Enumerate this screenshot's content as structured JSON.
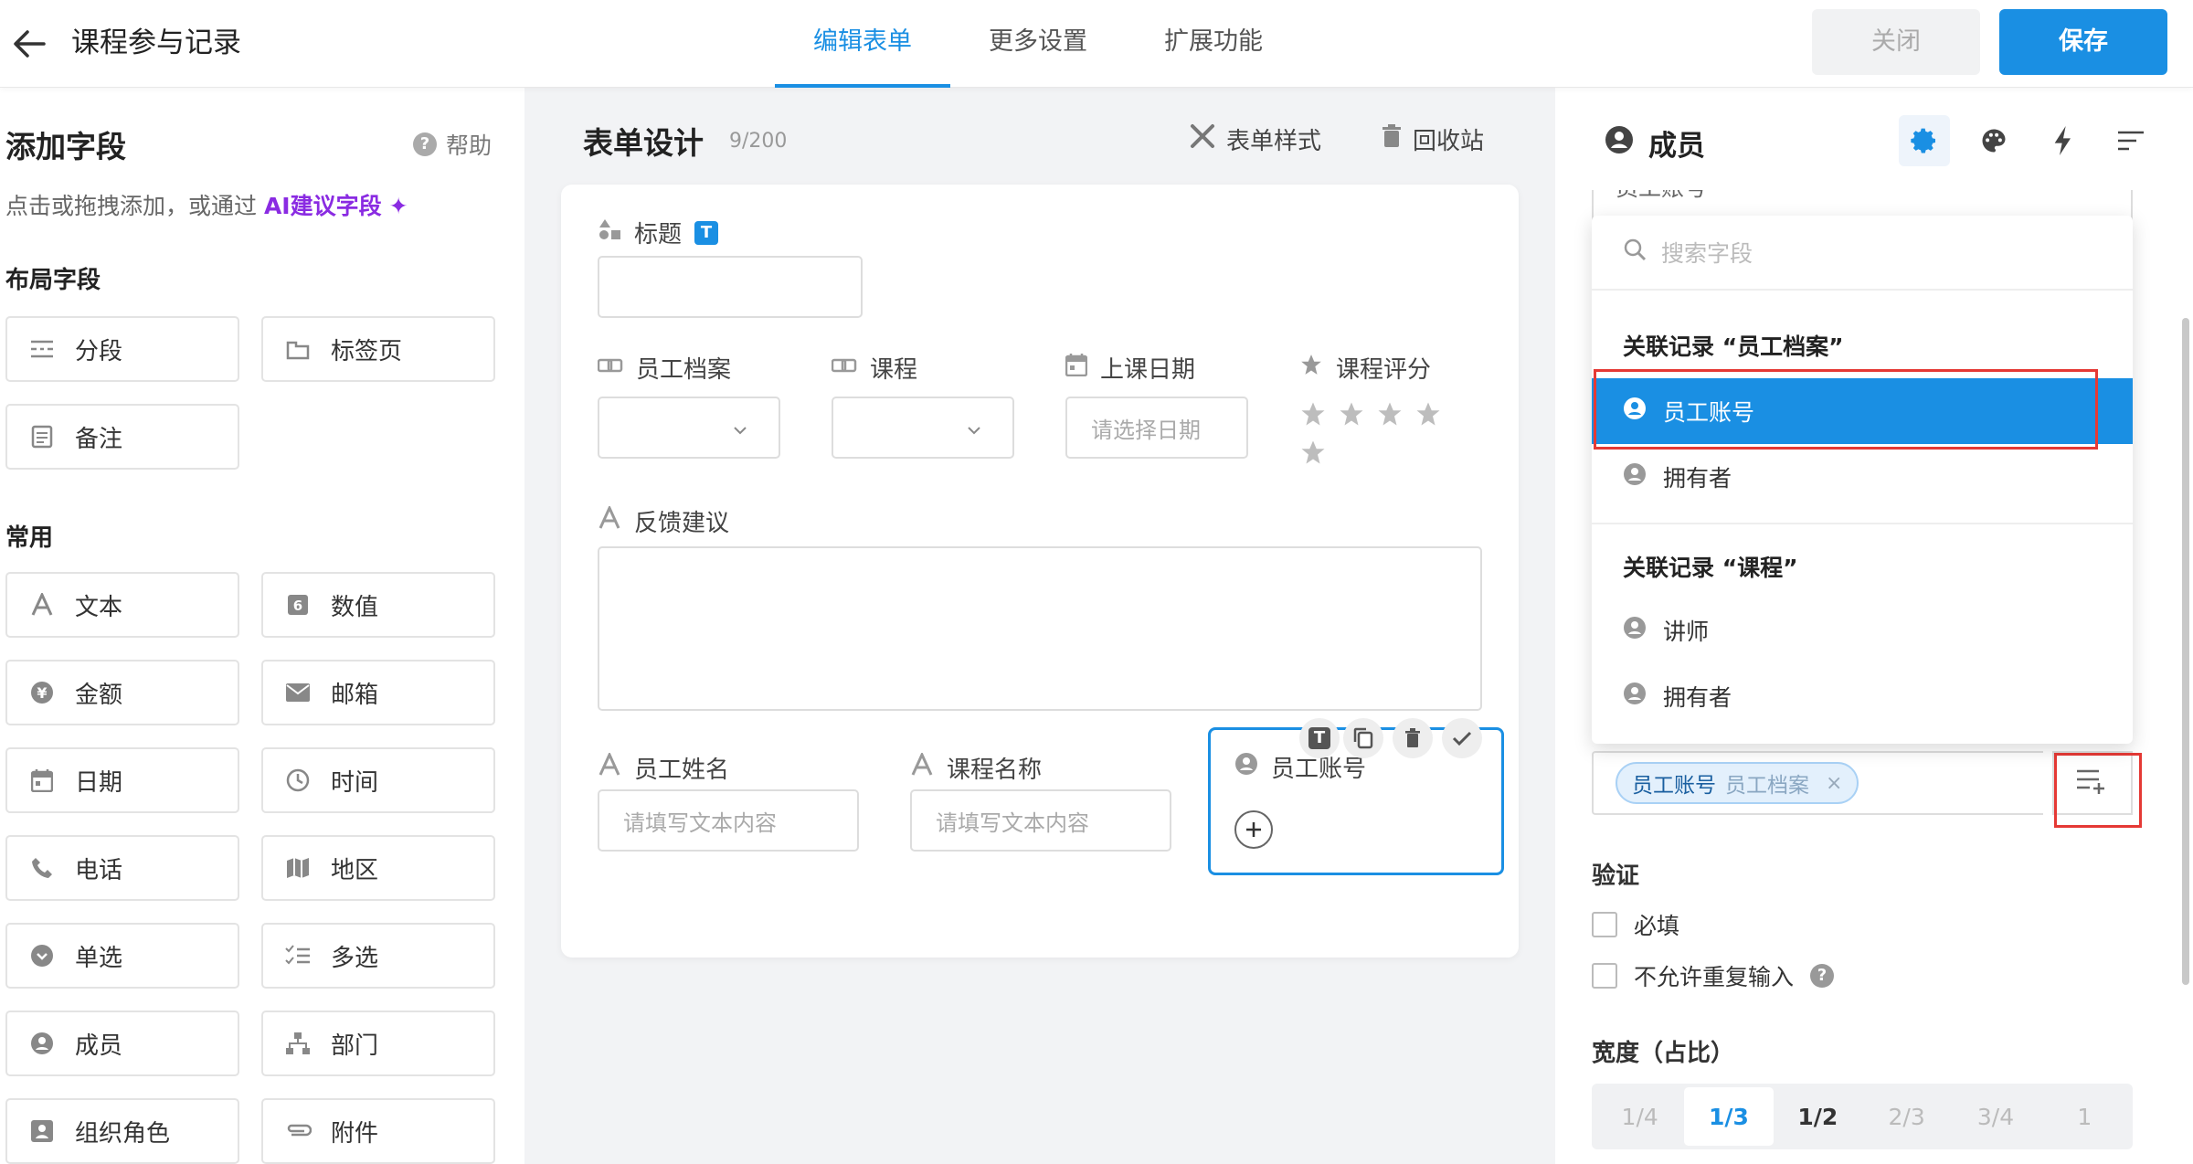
{
  "header": {
    "title": "课程参与记录",
    "tabs": [
      {
        "label": "编辑表单"
      },
      {
        "label": "更多设置"
      },
      {
        "label": "扩展功能"
      }
    ],
    "close_label": "关闭",
    "save_label": "保存",
    "accent": "#1a8fe3"
  },
  "sidebar": {
    "title": "添加字段",
    "help_label": "帮助",
    "hint_prefix": "点击或拖拽添加，或通过 ",
    "hint_ai": "AI建议字段",
    "layout_title": "布局字段",
    "layout_items": [
      {
        "label": "分段",
        "icon": "section-icon"
      },
      {
        "label": "标签页",
        "icon": "tab-page-icon"
      },
      {
        "label": "备注",
        "icon": "note-icon"
      }
    ],
    "common_title": "常用",
    "common_items": [
      {
        "label": "文本",
        "icon": "text-icon"
      },
      {
        "label": "数值",
        "icon": "number-icon"
      },
      {
        "label": "金额",
        "icon": "currency-icon"
      },
      {
        "label": "邮箱",
        "icon": "email-icon"
      },
      {
        "label": "日期",
        "icon": "calendar-icon"
      },
      {
        "label": "时间",
        "icon": "clock-icon"
      },
      {
        "label": "电话",
        "icon": "phone-icon"
      },
      {
        "label": "地区",
        "icon": "map-icon"
      },
      {
        "label": "单选",
        "icon": "radio-icon"
      },
      {
        "label": "多选",
        "icon": "checklist-icon"
      },
      {
        "label": "成员",
        "icon": "member-icon"
      },
      {
        "label": "部门",
        "icon": "org-chart-icon"
      },
      {
        "label": "组织角色",
        "icon": "role-card-icon"
      },
      {
        "label": "附件",
        "icon": "paperclip-icon"
      }
    ]
  },
  "middle": {
    "title": "表单设计",
    "count": "9/200",
    "style_label": "表单样式",
    "recycle_label": "回收站",
    "fields": {
      "title_label": "标题",
      "title_badge": "T",
      "employee_file_label": "员工档案",
      "course_label": "课程",
      "class_date_label": "上课日期",
      "class_date_placeholder": "请选择日期",
      "course_rating_label": "课程评分",
      "rating_stars": 5,
      "feedback_label": "反馈建议",
      "employee_name_label": "员工姓名",
      "employee_name_placeholder": "请填写文本内容",
      "course_name_label": "课程名称",
      "course_name_placeholder": "请填写文本内容",
      "employee_account_label": "员工账号",
      "toolbar_badge": "T"
    }
  },
  "right": {
    "title": "成员",
    "clipped_text": "员工账号",
    "search_placeholder": "搜索字段",
    "groups": [
      {
        "title": "关联记录 “员工档案”",
        "items": [
          {
            "label": "员工账号",
            "selected": true
          },
          {
            "label": "拥有者",
            "selected": false
          }
        ]
      },
      {
        "title": "关联记录 “课程”",
        "items": [
          {
            "label": "讲师",
            "selected": false
          },
          {
            "label": "拥有者",
            "selected": false
          }
        ]
      }
    ],
    "tag_field": "员工账号",
    "tag_source": "员工档案",
    "validation_title": "验证",
    "required_label": "必填",
    "no_duplicate_label": "不允许重复输入",
    "width_title": "宽度（占比）",
    "width_options": [
      "1/4",
      "1/3",
      "1/2",
      "2/3",
      "3/4",
      "1"
    ],
    "width_active": "1/3"
  }
}
